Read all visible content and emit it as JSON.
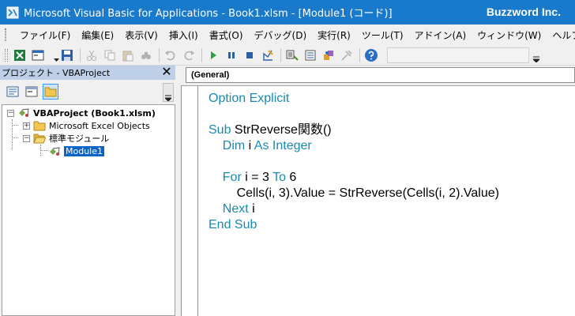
{
  "window": {
    "title": "Microsoft Visual Basic for Applications - Book1.xlsm - [Module1 (コード)]",
    "brand": "Buzzword Inc."
  },
  "menu": {
    "items": [
      "ファイル(F)",
      "編集(E)",
      "表示(V)",
      "挿入(I)",
      "書式(O)",
      "デバッグ(D)",
      "実行(R)",
      "ツール(T)",
      "アドイン(A)",
      "ウィンドウ(W)",
      "ヘルプ(H)"
    ]
  },
  "project_panel": {
    "title": "プロジェクト - VBAProject",
    "close_glyph": "✕",
    "tree": {
      "project": "VBAProject (Book1.xlsm)",
      "excel_objects": "Microsoft Excel Objects",
      "standard_modules": "標準モジュール",
      "module": "Module1",
      "collapsed_glyph": "+",
      "expanded_glyph": "−"
    }
  },
  "code_window": {
    "object_combo": "(General)",
    "lines": [
      [
        {
          "t": "Option Explicit",
          "k": true
        }
      ],
      [],
      [
        {
          "t": "Sub ",
          "k": true
        },
        {
          "t": "StrReverse関数()",
          "k": false
        }
      ],
      [
        {
          "t": "    Dim ",
          "k": true
        },
        {
          "t": "i ",
          "k": false
        },
        {
          "t": "As Integer",
          "k": true
        }
      ],
      [],
      [
        {
          "t": "    For ",
          "k": true
        },
        {
          "t": "i = 3 ",
          "k": false
        },
        {
          "t": "To ",
          "k": true
        },
        {
          "t": "6",
          "k": false
        }
      ],
      [
        {
          "t": "        Cells(i, 3).Value = StrReverse(Cells(i, 2).Value)",
          "k": false
        }
      ],
      [
        {
          "t": "    Next ",
          "k": true
        },
        {
          "t": "i",
          "k": false
        }
      ],
      [
        {
          "t": "End Sub",
          "k": true
        }
      ]
    ]
  },
  "colors": {
    "titlebar": "#1979ca",
    "keyword": "#1a8ab0",
    "selection": "#0a64c8"
  }
}
